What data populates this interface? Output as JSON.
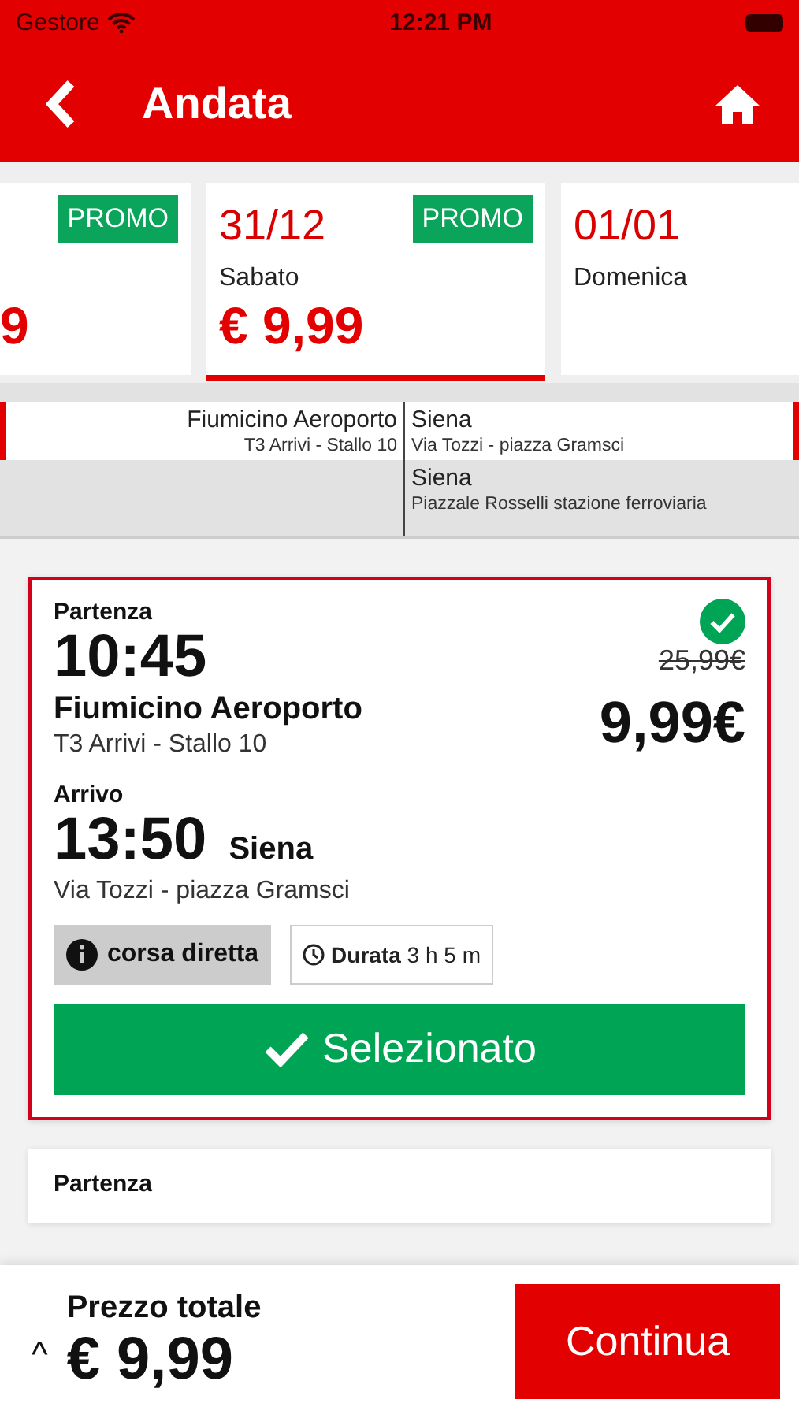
{
  "status_bar": {
    "carrier": "Gestore",
    "time": "12:21 PM"
  },
  "header": {
    "title": "Andata"
  },
  "dates": [
    {
      "price": "9",
      "promo": "PROMO",
      "selected": false,
      "kind": "partial"
    },
    {
      "date": "31/12",
      "weekday": "Sabato",
      "price": "€ 9,99",
      "promo": "PROMO",
      "selected": true,
      "kind": "full"
    },
    {
      "date": "01/01",
      "weekday": "Domenica",
      "selected": false,
      "kind": "full"
    }
  ],
  "routes": [
    {
      "from": {
        "name": "Fiumicino Aeroporto",
        "stop": "T3 Arrivi - Stallo 10"
      },
      "to": {
        "name": "Siena",
        "stop": "Via Tozzi - piazza Gramsci"
      },
      "selected": true
    },
    {
      "to": {
        "name": "Siena",
        "stop": "Piazzale Rosselli stazione ferroviaria"
      },
      "selected": false
    }
  ],
  "trips": [
    {
      "departure_label": "Partenza",
      "departure_time": "10:45",
      "departure_place": "Fiumicino Aeroporto",
      "departure_stop": "T3 Arrivi - Stallo 10",
      "arrival_label": "Arrivo",
      "arrival_time": "13:50",
      "arrival_place": "Siena",
      "arrival_stop": "Via Tozzi - piazza Gramsci",
      "old_price": "25,99€",
      "price": "9,99€",
      "info": "corsa diretta",
      "duration": "**Durata** 3 h 5 m",
      "button": "Selezionato",
      "selected": true
    },
    {
      "departure_label": "Partenza",
      "selected": false
    }
  ],
  "footer": {
    "caret": "^",
    "label": "Prezzo totale",
    "total": "€ 9,99",
    "button": "Continua"
  }
}
